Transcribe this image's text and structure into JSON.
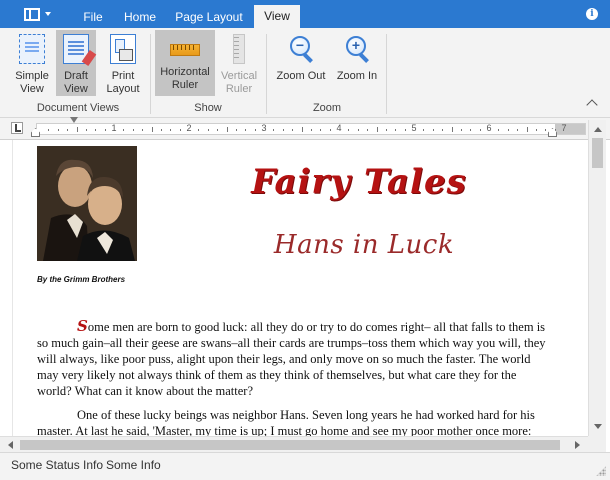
{
  "tabs": [
    {
      "label": "File",
      "active": false
    },
    {
      "label": "Home",
      "active": false
    },
    {
      "label": "Page Layout",
      "active": false
    },
    {
      "label": "View",
      "active": true
    }
  ],
  "ribbon": {
    "groups": [
      {
        "label": "Document Views",
        "buttons": [
          {
            "line1": "Simple",
            "line2": "View",
            "icon": "simple-view-icon",
            "pressed": false,
            "enabled": true
          },
          {
            "line1": "Draft",
            "line2": "View",
            "icon": "draft-view-icon",
            "pressed": true,
            "enabled": true
          },
          {
            "line1": "Print",
            "line2": "Layout",
            "icon": "print-layout-icon",
            "pressed": false,
            "enabled": true
          }
        ]
      },
      {
        "label": "Show",
        "buttons": [
          {
            "line1": "Horizontal",
            "line2": "Ruler",
            "icon": "horizontal-ruler-icon",
            "pressed": true,
            "enabled": true
          },
          {
            "line1": "Vertical",
            "line2": "Ruler",
            "icon": "vertical-ruler-icon",
            "pressed": false,
            "enabled": false
          }
        ]
      },
      {
        "label": "Zoom",
        "buttons": [
          {
            "line1": "Zoom Out",
            "line2": "",
            "icon": "zoom-out-icon",
            "pressed": false,
            "enabled": true
          },
          {
            "line1": "Zoom In",
            "line2": "",
            "icon": "zoom-in-icon",
            "pressed": false,
            "enabled": true
          }
        ]
      }
    ]
  },
  "ruler": {
    "numbers": [
      "1",
      "2",
      "3",
      "4",
      "5",
      "6",
      "7"
    ]
  },
  "document": {
    "byline": "By the Grimm Brothers",
    "title": "Fairy Tales",
    "subtitle": "Hans in Luck",
    "drop_cap": "S",
    "paragraph1": "ome men are born to good luck: all they do or try to do comes right– all that falls to them is so much gain–all their geese are swans–all their cards are trumps–toss them which way you will, they will always, like poor puss, alight upon their legs, and only move on so much the faster. The world may very likely not always think of them as they think of themselves, but what care they for the world? What can it know about the matter?",
    "paragraph2": "One of these lucky beings was neighbor Hans. Seven long years he had worked hard for his master. At last he said, 'Master, my time is up; I must go home and see my poor mother once more:"
  },
  "status": {
    "item1": "Some Status Info",
    "item2": "Some Info"
  },
  "colors": {
    "accent": "#2b79d0",
    "title_red": "#b51212",
    "pressed": "#c4c4c4"
  }
}
